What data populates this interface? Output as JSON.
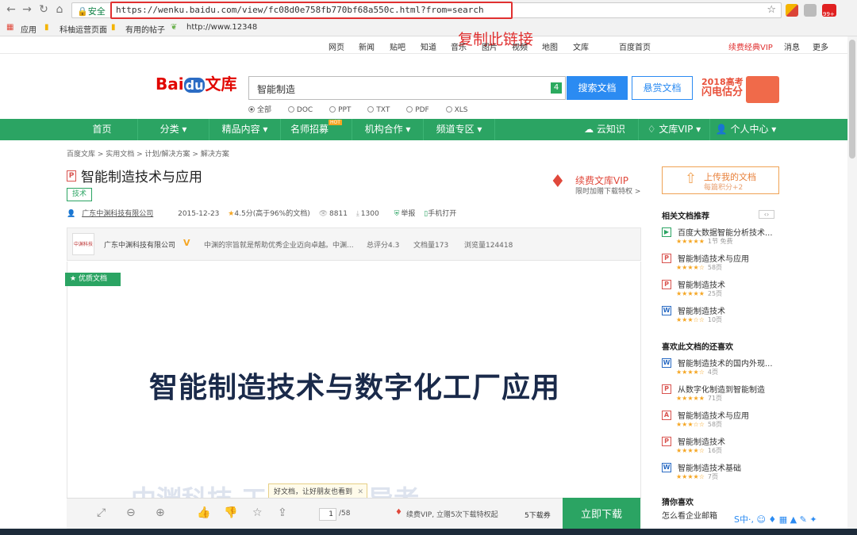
{
  "browser": {
    "secure_label": "安全",
    "url": "https://wenku.baidu.com/view/fc08d0e758fb770bf68a550c.html?from=search",
    "ext_badge": "99+",
    "bookmarks": [
      "应用",
      "科柚运营页面",
      "有用的帖子",
      "http://www.12348"
    ]
  },
  "annotation": "复制此链接",
  "top_links": [
    "网页",
    "新闻",
    "贴吧",
    "知道",
    "音乐",
    "图片",
    "视频",
    "地图",
    "文库",
    "百度首页",
    "续费经典VIP",
    "消息",
    "更多"
  ],
  "header": {
    "logo_bai": "Bai",
    "logo_du": "du",
    "logo_wenku": "文库",
    "search_value": "智能制造",
    "search_badge": "4",
    "search_button": "搜索文档",
    "reward_button": "悬赏文档",
    "promo_line1": "2018高考",
    "promo_line2": "闪电估分",
    "filters": [
      "全部",
      "DOC",
      "PPT",
      "TXT",
      "PDF",
      "XLS"
    ]
  },
  "nav": [
    "首页",
    "分类",
    "精品内容",
    "名师招募",
    "机构合作",
    "频道专区",
    "云知识",
    "文库VIP",
    "个人中心"
  ],
  "nav_hot": "HOT",
  "doc": {
    "breadcrumb": "百度文库 > 实用文档 > 计划/解决方案 > 解决方案",
    "type_badge": "P",
    "title": "智能制造技术与应用",
    "tag": "技术",
    "publisher": "广东中渊科技有限公司",
    "date": "2015-12-23",
    "rating": "4.5分(高于96%的文档)",
    "views": "8811",
    "downloads": "1300",
    "report": "举报",
    "mobile": "手机打开",
    "vip_title": "续费文库VIP",
    "vip_sub": "限时加赠下载特权 >",
    "author_name": "广东中渊科技有限公司",
    "author_desc": "中渊的宗旨就是帮助优秀企业迈向卓越。中渊...",
    "author_score": "总评分4.3",
    "author_docs": "文档量173",
    "author_views": "浏览量124418",
    "author_logo_text": "中渊科技",
    "quality_badge": "优质文档",
    "heading": "智能制造技术与数字化工厂应用",
    "bottom_text": "中渊科技   工厂设计领导者",
    "tooltip": "好文档，让好朋友也看到",
    "page_current": "1",
    "page_total": "/58",
    "toolbar_vip": "续费VIP, 立赠5次下载特权起",
    "toolbar_coupon": "5下载券",
    "download_button": "立即下载"
  },
  "sidebar": {
    "upload_title": "上传我的文档",
    "upload_sub": "每篇积分+2",
    "related_title": "相关文档推荐",
    "related": [
      {
        "icon": "▶",
        "title": "百度大数据智能分析技术...",
        "stars": "★★★★★",
        "sub": "1节  免费",
        "color": "#2ba463"
      },
      {
        "icon": "P",
        "title": "智能制造技术与应用",
        "stars": "★★★★☆",
        "sub": "58页",
        "color": "#d9534f"
      },
      {
        "icon": "P",
        "title": "智能制造技术",
        "stars": "★★★★★",
        "sub": "25页",
        "color": "#d9534f"
      },
      {
        "icon": "W",
        "title": "智能制造技术",
        "stars": "★★★☆☆",
        "sub": "10页",
        "color": "#2b6cc4"
      }
    ],
    "liked_title": "喜欢此文档的还喜欢",
    "liked": [
      {
        "icon": "W",
        "title": "智能制造技术的国内外现...",
        "stars": "★★★★☆",
        "sub": "4页",
        "color": "#2b6cc4"
      },
      {
        "icon": "P",
        "title": "从数字化制造到智能制造",
        "stars": "★★★★★",
        "sub": "71页",
        "color": "#d9534f"
      },
      {
        "icon": "A",
        "title": "智能制造技术与应用",
        "stars": "★★★☆☆",
        "sub": "58页",
        "color": "#d9534f"
      },
      {
        "icon": "P",
        "title": "智能制造技术",
        "stars": "★★★★☆",
        "sub": "16页",
        "color": "#d9534f"
      },
      {
        "icon": "W",
        "title": "智能制造技术基础",
        "stars": "★★★★☆",
        "sub": "7页",
        "color": "#2b6cc4"
      }
    ],
    "guess_title": "猜你喜欢",
    "guess_item": "怎么看企业邮箱"
  },
  "ime": "S中·, ☺ ♦ ▦ ▲ ✎ ✦"
}
